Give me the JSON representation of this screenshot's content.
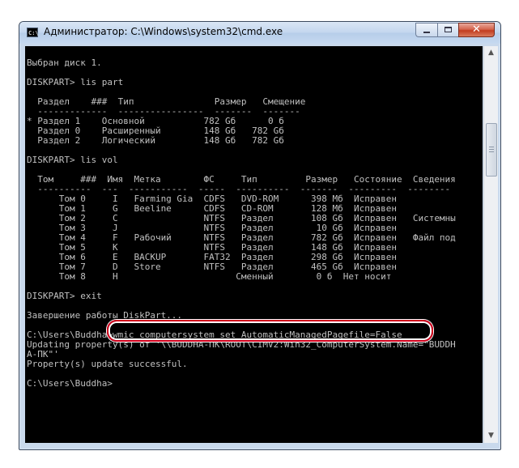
{
  "window": {
    "title": "Администратор: C:\\Windows\\system32\\cmd.exe",
    "icon_text": "C:\\",
    "close_glyph": "✕"
  },
  "console": {
    "lines": [
      "",
      "Выбран диск 1.",
      "",
      "DISKPART> lis part",
      "",
      "  Раздел    ###  Тип               Размер   Смещение",
      "  -------------  ----------------  -------  -------",
      "* Раздел 1    Основной           782 Gб      0 б",
      "  Раздел 0    Расширенный        148 Gб   782 Gб",
      "  Раздел 2    Логический         148 Gб   782 Gб",
      "",
      "DISKPART> lis vol",
      "",
      "  Том     ###  Имя  Метка        ФС     Тип         Размер   Состояние  Сведения",
      "  ----------  ---  -----------  -----  ----------  -------  ---------  --------",
      "      Том 0     I   Farming Gia  CDFS   DVD-ROM      398 Мб  Исправен",
      "      Том 1     G   Beeline      CDFS   CD-ROM       128 Мб  Исправен",
      "      Том 2     C                NTFS   Раздел       108 Gб  Исправен   Системны",
      "      Том 3     J                NTFS   Раздел        10 Gб  Исправен",
      "      Том 4     F   Рабочий      NTFS   Раздел       782 Gб  Исправен   Файл под",
      "      Том 5     K                NTFS   Раздел       148 Gб  Исправен",
      "      Том 6     E   BACKUP       FAT32  Раздел       298 Gб  Исправен",
      "      Том 7     D   Store        NTFS   Раздел       465 Gб  Исправен",
      "      Том 8     H                      Сменный        0 б  Нет носит",
      "",
      "DISKPART> exit",
      "",
      "Завершение работы DiskPart...",
      "",
      "C:\\Users\\Buddha>wmic computersystem set AutomaticManagedPagefile=False",
      "Updating property(s) of '\\\\BUDDHA-ПК\\ROOT\\CIMV2:Win32_ComputerSystem.Name=\"BUDDH",
      "А-ПК\"'",
      "Property(s) update successful.",
      "",
      "C:\\Users\\Buddha>"
    ]
  },
  "scrollbar": {
    "up_glyph": "▲",
    "down_glyph": "▼"
  }
}
